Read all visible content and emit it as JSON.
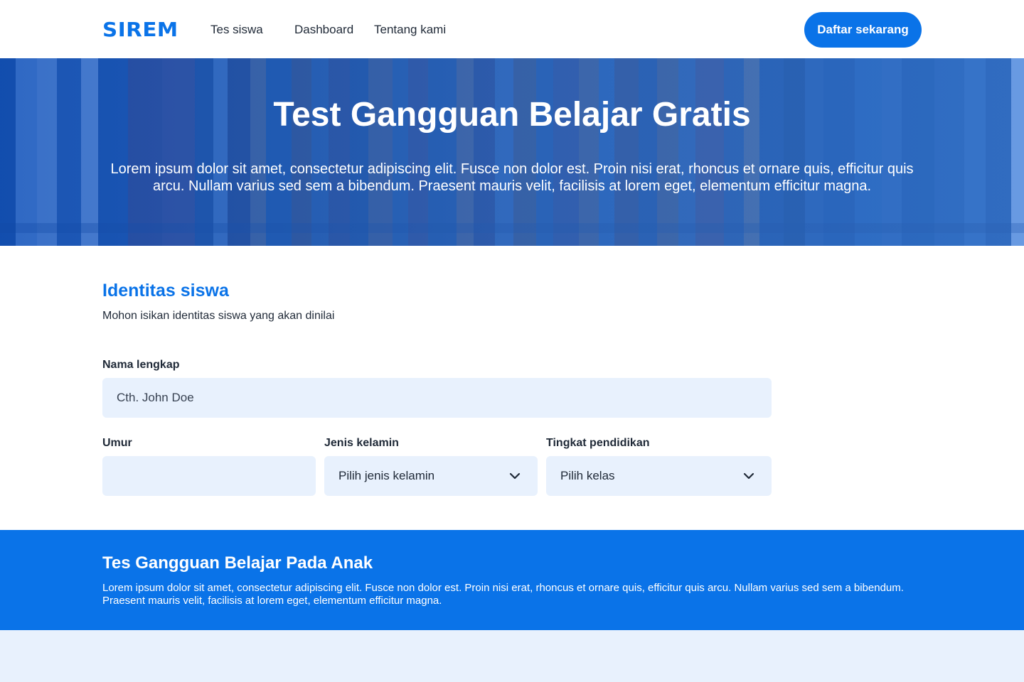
{
  "nav": {
    "logo": "SIREM",
    "links": [
      "Tes siswa",
      "Dashboard",
      "Tentang kami"
    ],
    "cta": "Daftar sekarang"
  },
  "hero": {
    "title": "Test Gangguan Belajar Gratis",
    "text": "Lorem ipsum dolor sit amet, consectetur adipiscing elit. Fusce non dolor est. Proin nisi erat, rhoncus et ornare quis, efficitur quis arcu. Nullam varius sed sem a bibendum. Praesent mauris velit, facilisis at lorem eget, elementum efficitur magna."
  },
  "form": {
    "title": "Identitas siswa",
    "subtitle": "Mohon isikan identitas siswa yang akan dinilai",
    "name_label": "Nama lengkap",
    "name_placeholder": "Cth. John Doe",
    "age_label": "Umur",
    "age_value": "",
    "gender_label": "Jenis kelamin",
    "gender_value": "Pilih jenis kelamin",
    "education_label": "Tingkat pendidikan",
    "education_value": "Pilih kelas"
  },
  "band": {
    "title": "Tes Gangguan Belajar Pada Anak",
    "text": "Lorem ipsum dolor sit amet, consectetur adipiscing elit. Fusce non dolor est. Proin nisi erat, rhoncus et ornare quis, efficitur quis arcu. Nullam varius sed sem a bibendum. Praesent mauris velit, facilisis at lorem eget, elementum efficitur magna."
  },
  "colors": {
    "accent": "#0a73e8",
    "field_bg": "#e8f1fd",
    "text": "#1f2937"
  },
  "icons": {
    "select_arrow": "chevron-down-icon"
  }
}
